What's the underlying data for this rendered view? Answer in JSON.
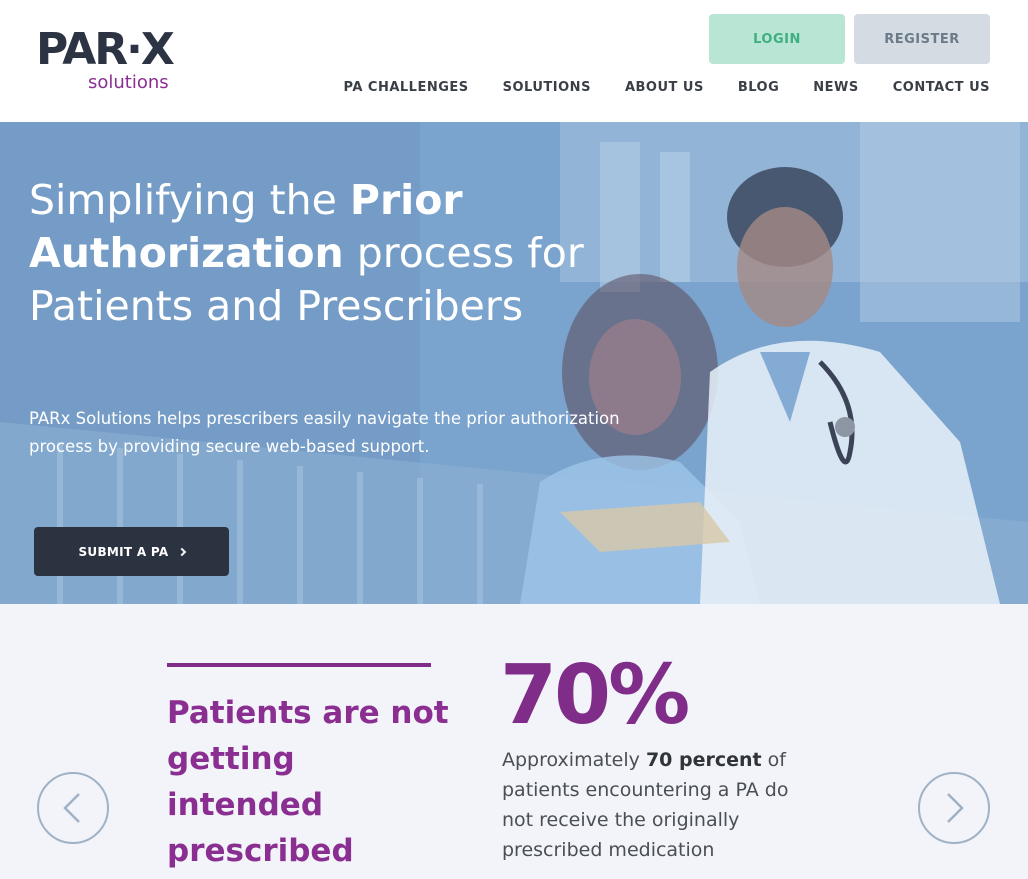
{
  "header": {
    "logo": {
      "brand": "PAR·X",
      "tagline": "solutions"
    },
    "login_label": "LOGIN",
    "register_label": "REGISTER",
    "nav": [
      {
        "label": "PA CHALLENGES"
      },
      {
        "label": "SOLUTIONS"
      },
      {
        "label": "ABOUT US"
      },
      {
        "label": "BLOG"
      },
      {
        "label": "NEWS"
      },
      {
        "label": "CONTACT US"
      }
    ]
  },
  "hero": {
    "title_part1": "Simplifying the ",
    "title_bold1": "Prior Authorization",
    "title_part2": " process for Patients and Prescribers",
    "description": "PARx Solutions helps prescribers easily navigate the prior authorization process by providing secure web-based support.",
    "cta_label": "SUBMIT A PA"
  },
  "stat": {
    "headline_part1": "Patients are not getting ",
    "headline_bold": "intended prescribed medications",
    "big_number": "70%",
    "desc_part1": "Approximately ",
    "desc_bold": "70 percent",
    "desc_part2": " of patients encountering a PA do not receive the originally prescribed medication"
  },
  "colors": {
    "brand_purple": "#8a2f91",
    "brand_dark": "#2c3443",
    "login_bg": "#b9e6d4",
    "register_bg": "#d4dbe2",
    "hero_overlay": "#7aa3cd",
    "stats_bg": "#f2f4f9"
  },
  "icons": {
    "prev": "chevron-left-icon",
    "next": "chevron-right-icon",
    "cta": "chevron-right-icon"
  }
}
